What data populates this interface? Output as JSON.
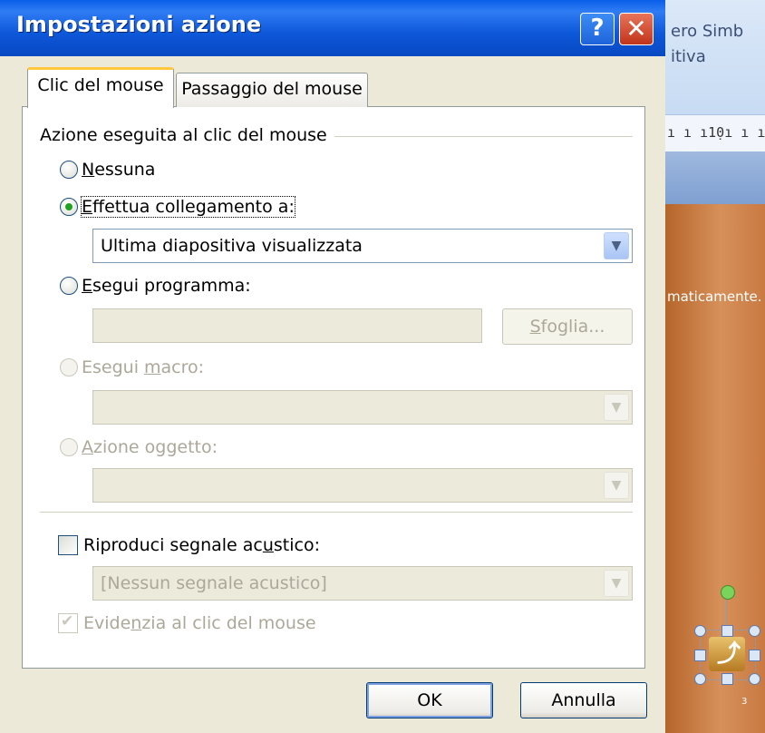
{
  "dialog": {
    "title": "Impostazioni azione",
    "help_label": "?",
    "close_label": "✕",
    "tabs": [
      {
        "label": "Clic del mouse",
        "active": true
      },
      {
        "label": "Passaggio del mouse",
        "active": false
      }
    ],
    "group_label": "Azione eseguita al clic del mouse",
    "options": {
      "none": {
        "prefix": "",
        "accel": "N",
        "rest": "essuna",
        "selected": false,
        "enabled": true
      },
      "link": {
        "prefix": "",
        "accel": "E",
        "rest": "ffettua collegamento a:",
        "selected": true,
        "enabled": true
      },
      "run_program": {
        "prefix": "",
        "accel": "E",
        "rest": "segui programma:",
        "selected": false,
        "enabled": true
      },
      "run_macro": {
        "prefix": "Esegui ",
        "accel": "m",
        "rest": "acro:",
        "selected": false,
        "enabled": false
      },
      "object_action": {
        "prefix": "",
        "accel": "A",
        "rest": "zione oggetto:",
        "selected": false,
        "enabled": false
      }
    },
    "link_target": "Ultima diapositiva visualizzata",
    "program_value": "",
    "browse": {
      "prefix": "",
      "accel": "S",
      "rest": "foglia..."
    },
    "macro_value": "",
    "object_action_value": "",
    "play_sound": {
      "prefix": "Riproduci segnale ac",
      "accel": "u",
      "rest": "stico:",
      "checked": false
    },
    "sound_value": "[Nessun segnale acustico]",
    "highlight": {
      "prefix": "Evide",
      "accel": "n",
      "rest": "zia al clic del mouse",
      "checked": true,
      "enabled": false
    },
    "ok_label": "OK",
    "cancel_label": "Annulla"
  },
  "background": {
    "ribbon_line1": "ero   Simb",
    "ribbon_line2": "itiva",
    "ruler_text": "ı ı ı1̣0ı ı ı",
    "slide_text": "maticamente.",
    "slide_number": "3"
  },
  "colors": {
    "title_bar": "#0a5fe8",
    "dialog_bg": "#ece9d8",
    "selected_radio": "#21a121",
    "tab_highlight": "#ffc83c",
    "slide_bg": "#c97a42"
  }
}
